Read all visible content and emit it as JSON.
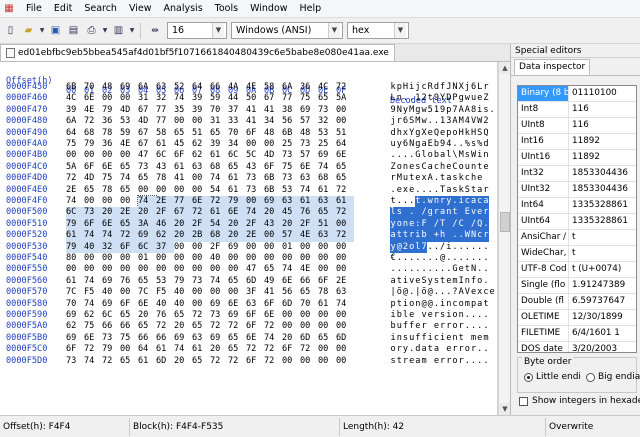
{
  "menu": {
    "items": [
      "File",
      "Edit",
      "Search",
      "View",
      "Analysis",
      "Tools",
      "Window",
      "Help"
    ]
  },
  "toolbar": {
    "bytes_per_row": "16",
    "charset": "Windows (ANSI)",
    "display_mode": "hex"
  },
  "tab": {
    "filename": "ed01ebfbc9eb5bbea545af4d01bf5f1071661840480439c6e5babe8e080e41aa.exe"
  },
  "hex_view": {
    "offset_header": "Offset(h)",
    "column_headers": [
      "00",
      "01",
      "02",
      "03",
      "04",
      "05",
      "06",
      "07",
      "08",
      "09",
      "0A",
      "0B",
      "0C",
      "0D",
      "0E",
      "0F"
    ],
    "text_header": "Decoded text",
    "rows": [
      {
        "offset": "0000F450",
        "bytes": [
          "6B",
          "70",
          "48",
          "69",
          "6A",
          "63",
          "52",
          "64",
          "66",
          "4A",
          "4E",
          "58",
          "6A",
          "36",
          "4C",
          "72"
        ],
        "text": "kpHijcRdfJNXj6Lr"
      },
      {
        "offset": "0000F460",
        "bytes": [
          "4C",
          "6E",
          "00",
          "00",
          "31",
          "32",
          "74",
          "39",
          "59",
          "44",
          "50",
          "67",
          "77",
          "75",
          "65",
          "5A"
        ],
        "text": "Ln..12t9YDPgwueZ"
      },
      {
        "offset": "0000F470",
        "bytes": [
          "39",
          "4E",
          "79",
          "4D",
          "67",
          "77",
          "35",
          "39",
          "70",
          "37",
          "41",
          "41",
          "38",
          "69",
          "73",
          "00"
        ],
        "text": "9NyMgw519p7AA8is."
      },
      {
        "offset": "0000F480",
        "bytes": [
          "6A",
          "72",
          "36",
          "53",
          "4D",
          "77",
          "00",
          "00",
          "31",
          "33",
          "41",
          "34",
          "56",
          "57",
          "32",
          "00"
        ],
        "text": "jr6SMw..13AM4VW2"
      },
      {
        "offset": "0000F490",
        "bytes": [
          "64",
          "68",
          "78",
          "59",
          "67",
          "58",
          "65",
          "51",
          "65",
          "70",
          "6F",
          "48",
          "6B",
          "48",
          "53",
          "51"
        ],
        "text": "dhxYgXeQepoHkHSQ"
      },
      {
        "offset": "0000F4A0",
        "bytes": [
          "75",
          "79",
          "36",
          "4E",
          "67",
          "61",
          "45",
          "62",
          "39",
          "34",
          "00",
          "00",
          "25",
          "73",
          "25",
          "64"
        ],
        "text": "uy6NgaEb94..%s%d"
      },
      {
        "offset": "0000F4B0",
        "bytes": [
          "00",
          "00",
          "00",
          "00",
          "47",
          "6C",
          "6F",
          "62",
          "61",
          "6C",
          "5C",
          "4D",
          "73",
          "57",
          "69",
          "6E"
        ],
        "text": "....Global\\MsWin"
      },
      {
        "offset": "0000F4C0",
        "bytes": [
          "5A",
          "6F",
          "6E",
          "65",
          "73",
          "43",
          "61",
          "63",
          "68",
          "65",
          "43",
          "6F",
          "75",
          "6E",
          "74",
          "65"
        ],
        "text": "ZonesCacheCounte"
      },
      {
        "offset": "0000F4D0",
        "bytes": [
          "72",
          "4D",
          "75",
          "74",
          "65",
          "78",
          "41",
          "00",
          "74",
          "61",
          "73",
          "6B",
          "73",
          "63",
          "68",
          "65"
        ],
        "text": "rMutexA.taskche"
      },
      {
        "offset": "0000F4E0",
        "bytes": [
          "2E",
          "65",
          "78",
          "65",
          "00",
          "00",
          "00",
          "00",
          "54",
          "61",
          "73",
          "6B",
          "53",
          "74",
          "61",
          "72"
        ],
        "text": ".exe....TaskStar"
      },
      {
        "offset": "0000F4F0",
        "bytes": [
          "74",
          "00",
          "00",
          "00",
          "74",
          "2E",
          "77",
          "6E",
          "72",
          "79",
          "00",
          "69",
          "63",
          "61",
          "63",
          "61"
        ],
        "text": "t...t.wnry.icaca"
      },
      {
        "offset": "0000F500",
        "bytes": [
          "6C",
          "73",
          "20",
          "2E",
          "20",
          "2F",
          "67",
          "72",
          "61",
          "6E",
          "74",
          "20",
          "45",
          "76",
          "65",
          "72"
        ],
        "text": "ls . /grant Ever"
      },
      {
        "offset": "0000F510",
        "bytes": [
          "79",
          "6F",
          "6E",
          "65",
          "3A",
          "46",
          "20",
          "2F",
          "54",
          "20",
          "2F",
          "43",
          "20",
          "2F",
          "51",
          "00"
        ],
        "text": "yone:F /T /C /Q."
      },
      {
        "offset": "0000F520",
        "bytes": [
          "61",
          "74",
          "74",
          "72",
          "69",
          "62",
          "20",
          "2B",
          "68",
          "20",
          "2E",
          "00",
          "57",
          "4E",
          "63",
          "72"
        ],
        "text": "attrib +h ..WNcr"
      },
      {
        "offset": "0000F530",
        "bytes": [
          "79",
          "40",
          "32",
          "6F",
          "6C",
          "37",
          "00",
          "00",
          "2F",
          "69",
          "00",
          "00",
          "01",
          "00",
          "00",
          "00"
        ],
        "text": "y@2ol7../i......"
      },
      {
        "offset": "0000F540",
        "bytes": [
          "80",
          "00",
          "00",
          "00",
          "01",
          "00",
          "00",
          "00",
          "40",
          "00",
          "00",
          "00",
          "00",
          "00",
          "00",
          "00"
        ],
        "text": "€.......@......."
      },
      {
        "offset": "0000F550",
        "bytes": [
          "00",
          "00",
          "00",
          "00",
          "00",
          "00",
          "00",
          "00",
          "00",
          "00",
          "47",
          "65",
          "74",
          "4E",
          "00",
          "00"
        ],
        "text": "..........GetN.."
      },
      {
        "offset": "0000F560",
        "bytes": [
          "61",
          "74",
          "69",
          "76",
          "65",
          "53",
          "79",
          "73",
          "74",
          "65",
          "6D",
          "49",
          "6E",
          "66",
          "6F",
          "2E"
        ],
        "text": "ativeSystemInfo."
      },
      {
        "offset": "0000F570",
        "bytes": [
          "7C",
          "F5",
          "40",
          "00",
          "7C",
          "F5",
          "40",
          "00",
          "00",
          "00",
          "3F",
          "41",
          "56",
          "65",
          "78",
          "63"
        ],
        "text": "|õ@.|õ@...?AVexce"
      },
      {
        "offset": "0000F580",
        "bytes": [
          "70",
          "74",
          "69",
          "6F",
          "6E",
          "40",
          "40",
          "00",
          "69",
          "6E",
          "63",
          "6F",
          "6D",
          "70",
          "61",
          "74"
        ],
        "text": "ption@@.incompat"
      },
      {
        "offset": "0000F590",
        "bytes": [
          "69",
          "62",
          "6C",
          "65",
          "20",
          "76",
          "65",
          "72",
          "73",
          "69",
          "6F",
          "6E",
          "00",
          "00",
          "00",
          "00"
        ],
        "text": "ible version...."
      },
      {
        "offset": "0000F5A0",
        "bytes": [
          "62",
          "75",
          "66",
          "66",
          "65",
          "72",
          "20",
          "65",
          "72",
          "72",
          "6F",
          "72",
          "00",
          "00",
          "00",
          "00"
        ],
        "text": "buffer error...."
      },
      {
        "offset": "0000F5B0",
        "bytes": [
          "69",
          "6E",
          "73",
          "75",
          "66",
          "66",
          "69",
          "63",
          "69",
          "65",
          "6E",
          "74",
          "20",
          "6D",
          "65",
          "6D"
        ],
        "text": "insufficient mem"
      },
      {
        "offset": "0000F5C0",
        "bytes": [
          "6F",
          "72",
          "79",
          "00",
          "64",
          "61",
          "74",
          "61",
          "20",
          "65",
          "72",
          "72",
          "6F",
          "72",
          "00",
          "00"
        ],
        "text": "ory.data error.."
      },
      {
        "offset": "0000F5D0",
        "bytes": [
          "73",
          "74",
          "72",
          "65",
          "61",
          "6D",
          "20",
          "65",
          "72",
          "72",
          "6F",
          "72",
          "00",
          "00",
          "00",
          "00"
        ],
        "text": "stream error...."
      }
    ]
  },
  "special_editors": {
    "title": "Special editors",
    "tab_label": "Data inspector",
    "rows": [
      {
        "label": "Binary (8 b",
        "value": "01110100"
      },
      {
        "label": "Int8",
        "value": "116"
      },
      {
        "label": "UInt8",
        "value": "116"
      },
      {
        "label": "Int16",
        "value": "11892"
      },
      {
        "label": "UInt16",
        "value": "11892"
      },
      {
        "label": "Int32",
        "value": "1853304436"
      },
      {
        "label": "UInt32",
        "value": "1853304436"
      },
      {
        "label": "Int64",
        "value": "1335328861"
      },
      {
        "label": "UInt64",
        "value": "1335328861"
      },
      {
        "label": "AnsiChar /",
        "value": "t"
      },
      {
        "label": "WideChar,",
        "value": "t"
      },
      {
        "label": "UTF-8 Cod",
        "value": "t (U+0074)"
      },
      {
        "label": "Single (flo",
        "value": "1.91247389"
      },
      {
        "label": "Double (fl",
        "value": "6.59737647"
      },
      {
        "label": "OLETIME",
        "value": "12/30/1899"
      },
      {
        "label": "FILETIME",
        "value": "6/4/1601 1"
      },
      {
        "label": "DOS date",
        "value": "3/20/2003"
      },
      {
        "label": "DOS time",
        "value": "17:35:17"
      }
    ],
    "byte_order_title": "Byte order",
    "little_endian_label": "Little endi",
    "big_endian_label": "Big endia",
    "show_hex_label": "Show integers in hexade"
  },
  "status": {
    "offset": "Offset(h): F4F4",
    "block": "Block(h): F4F4-F535",
    "length": "Length(h): 42",
    "mode": "Overwrite"
  }
}
